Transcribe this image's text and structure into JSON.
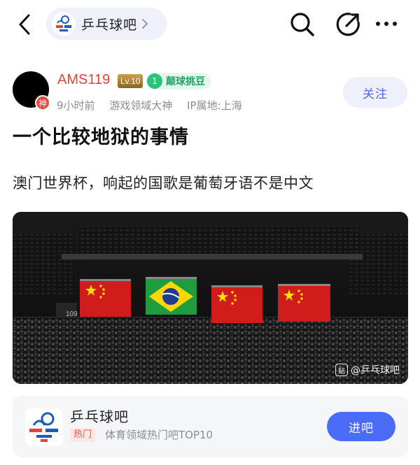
{
  "header": {
    "forum_name": "乒乓球吧"
  },
  "post": {
    "author": {
      "name": "AMS119",
      "avatar_badge": "神",
      "level": "Lv.10",
      "fan_level": "1",
      "fan_title": "颠球挑豆"
    },
    "meta": {
      "time": "9小时前",
      "author_tag": "游戏领域大神",
      "ip_location": "IP属地:上海"
    },
    "follow_label": "关注",
    "title": "一个比较地狱的事情",
    "body": "澳门世界杯，响起的国歌是葡萄牙语不是中文",
    "image": {
      "watermark": "@乒乓球吧",
      "scoreboard_number": "109"
    }
  },
  "forum_card": {
    "name": "乒乓球吧",
    "hot_tag": "热门",
    "rank_text": "体育领域热门吧TOP10",
    "enter_label": "进吧"
  },
  "colors": {
    "accent": "#4a6cf7",
    "username": "#e0453a",
    "pill_bg": "#eef0fb"
  }
}
